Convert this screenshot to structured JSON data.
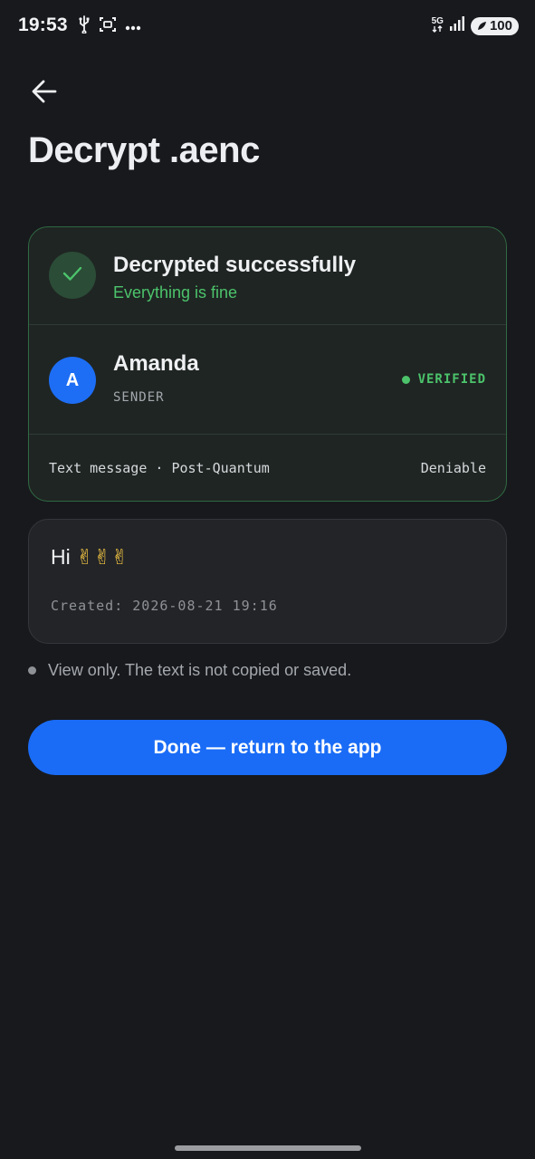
{
  "status_bar": {
    "time": "19:53",
    "network": "5G",
    "battery": "100",
    "icons": [
      "usb-icon",
      "screenshot-icon",
      "more-dots-icon",
      "signal-icon",
      "battery-icon"
    ]
  },
  "header": {
    "back_icon": "arrow-left-icon",
    "title": "Decrypt .aenc"
  },
  "result": {
    "status_title": "Decrypted successfully",
    "status_subtitle": "Everything is fine",
    "sender_initial": "A",
    "sender_name": "Amanda",
    "sender_role": "SENDER",
    "verified_label": "VERIFIED",
    "meta_left": "Text message · Post-Quantum",
    "meta_right": "Deniable"
  },
  "message": {
    "text": "Hi",
    "emoji": "✌✌✌",
    "created": "Created: 2026-08-21 19:16"
  },
  "note": "View only. The text is not copied or saved.",
  "done_button": "Done — return to the app",
  "colors": {
    "background": "#18191d",
    "success_green": "#4cc36b",
    "accent_blue": "#1a6cf6",
    "card_border_green": "#2f6a42"
  }
}
